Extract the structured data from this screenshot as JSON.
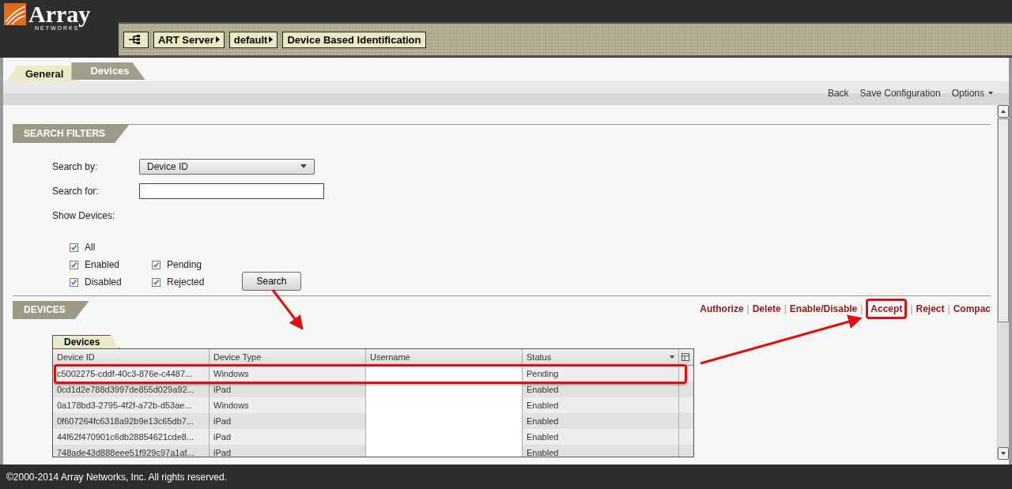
{
  "logo": {
    "name": "Array",
    "sub": "NETWORKS"
  },
  "breadcrumb": [
    {
      "label": "ART Server",
      "arrow": true
    },
    {
      "label": "default",
      "arrow": true
    },
    {
      "label": "Device Based Identification",
      "arrow": false
    }
  ],
  "tabs": [
    {
      "label": "General",
      "selected": false
    },
    {
      "label": "Devices",
      "selected": true
    }
  ],
  "toolbar": {
    "links": [
      "Back",
      "Save Configuration"
    ],
    "menu": "Options"
  },
  "search_filters": {
    "title": "SEARCH FILTERS",
    "search_by_label": "Search by:",
    "search_by_value": "Device ID",
    "search_for_label": "Search for:",
    "show_label": "Show Devices:",
    "checkbox_rows": [
      [
        {
          "label": "All",
          "checked": true
        }
      ],
      [
        {
          "label": "Enabled",
          "checked": true
        },
        {
          "label": "Pending",
          "checked": true
        }
      ],
      [
        {
          "label": "Disabled",
          "checked": true
        },
        {
          "label": "Rejected",
          "checked": true
        }
      ]
    ],
    "button": "Search"
  },
  "devices": {
    "title": "DEVICES",
    "separator": "|",
    "actions": [
      {
        "label": "Authorize",
        "highlighted": false
      },
      {
        "label": "Delete",
        "highlighted": false
      },
      {
        "label": "Enable/Disable",
        "highlighted": false
      },
      {
        "label": "Accept",
        "highlighted": true
      },
      {
        "label": "Reject",
        "highlighted": false
      },
      {
        "label": "Compac",
        "highlighted": false
      }
    ],
    "table_tab": "Devices",
    "columns": [
      "Device ID",
      "Device Type",
      "Username",
      "Status"
    ],
    "rows": [
      {
        "id": "c5002275-cddf-40c3-876e-c4487...",
        "type": "Windows",
        "status": "Pending",
        "highlighted": true
      },
      {
        "id": "0cd1d2e788d3997de855d029a92...",
        "type": "iPad",
        "status": "Enabled"
      },
      {
        "id": "0a178bd3-2795-4f2f-a72b-d53ae...",
        "type": "Windows",
        "status": "Enabled"
      },
      {
        "id": "0f607264fc6318a92b9e13c65db7...",
        "type": "iPad",
        "status": "Enabled"
      },
      {
        "id": "44f62f470901c6db28854621cde8...",
        "type": "iPad",
        "status": "Enabled"
      },
      {
        "id": "748ade43d888eee51f929c97a1af...",
        "type": "iPad",
        "status": "Enabled"
      }
    ]
  },
  "footer": "©2000-2014 Array Networks, Inc. All rights reserved."
}
